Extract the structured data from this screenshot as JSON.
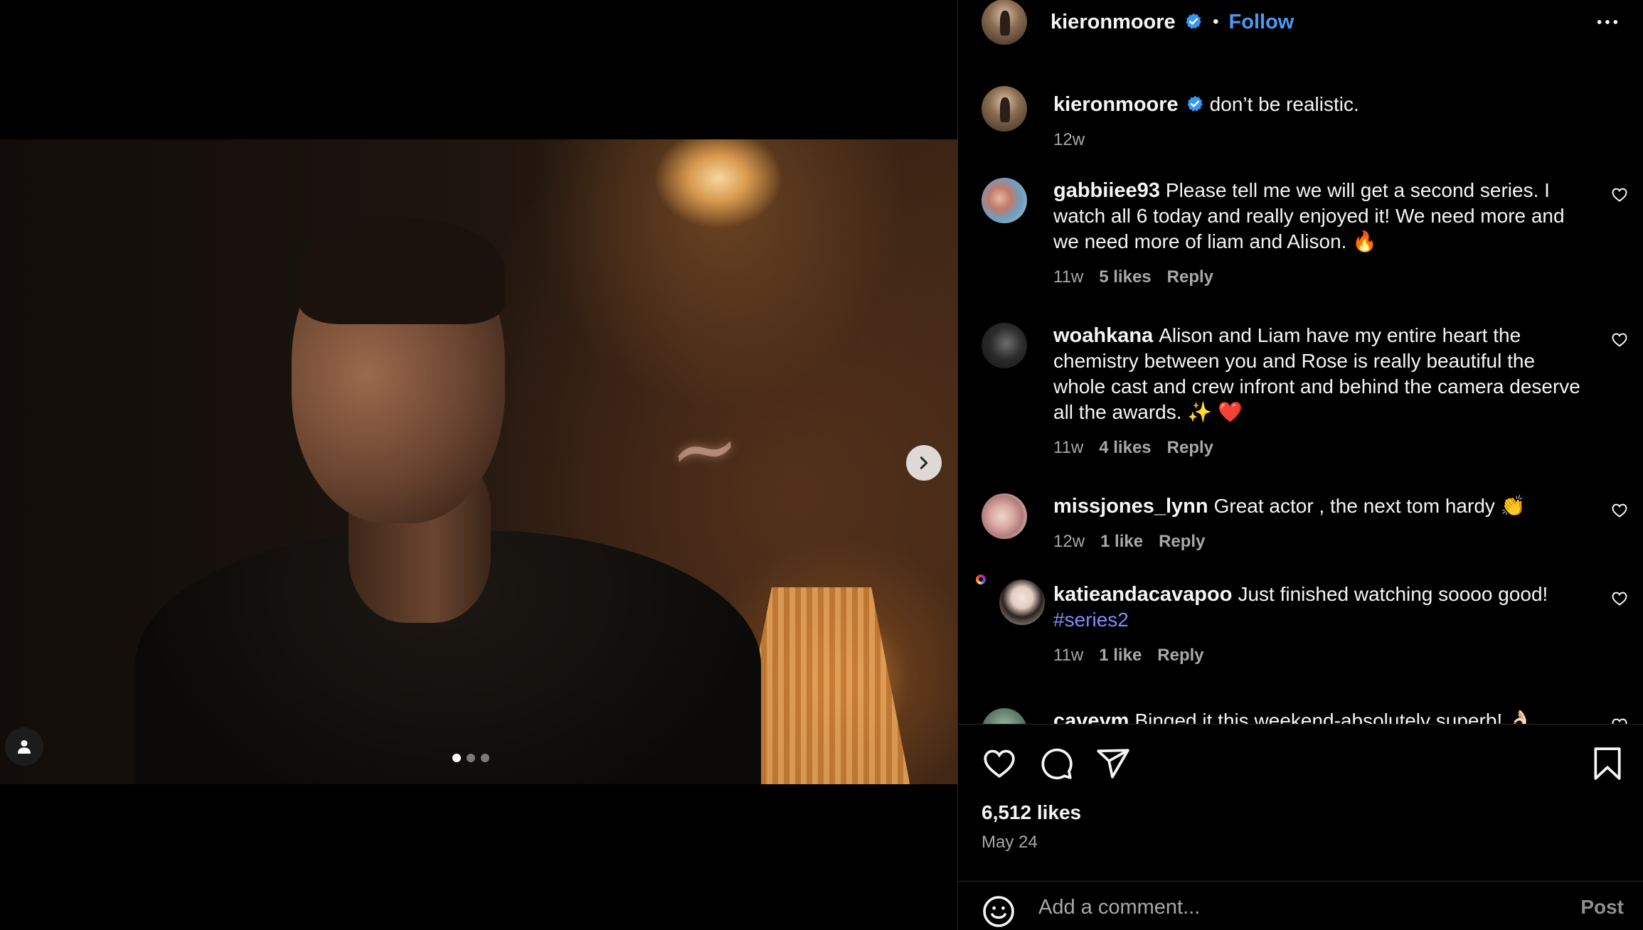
{
  "post": {
    "author": "kieronmoore",
    "follow_label": "Follow",
    "separator": "•",
    "caption": "don’t be realistic.",
    "caption_time": "12w",
    "likes": "6,512 likes",
    "date": "May 24",
    "carousel": {
      "count": 3,
      "active": 1
    }
  },
  "comments": [
    {
      "user": "gabbiiee93",
      "text": "Please tell me we will get a second series. I watch all 6 today and really enjoyed it! We need more and we need more of liam and Alison. 🔥",
      "time": "11w",
      "likes": "5 likes",
      "reply": "Reply"
    },
    {
      "user": "woahkana",
      "text": "Alison and Liam have my entire heart the chemistry between you and Rose is really beautiful the whole cast and crew infront and behind the camera deserve all the awards. ✨ ❤️",
      "time": "11w",
      "likes": "4 likes",
      "reply": "Reply"
    },
    {
      "user": "missjones_lynn",
      "text": "Great actor , the next tom hardy 👏",
      "time": "12w",
      "likes": "1 like",
      "reply": "Reply"
    },
    {
      "user": "katieandacavapoo",
      "text": "Just finished watching soooo good!",
      "hashtag": "#series2",
      "time": "11w",
      "likes": "1 like",
      "reply": "Reply"
    },
    {
      "user": "caveym",
      "text": "Binged it this weekend-absolutely superb! 👌🏻"
    }
  ],
  "add_comment": {
    "placeholder": "Add a comment...",
    "post_label": "Post"
  },
  "icons": {
    "header_more": "more-horizontal-icon",
    "verified": "verified-badge-icon",
    "like": "heart-icon",
    "comment": "comment-icon",
    "share": "send-icon",
    "save": "bookmark-icon",
    "emoji": "emoji-icon",
    "next": "chevron-right-icon",
    "tags": "user-tag-icon"
  },
  "colors": {
    "accent": "#4a99f5",
    "hashtag": "#7f8cff",
    "muted": "#a8a8a8",
    "background": "#000000"
  }
}
